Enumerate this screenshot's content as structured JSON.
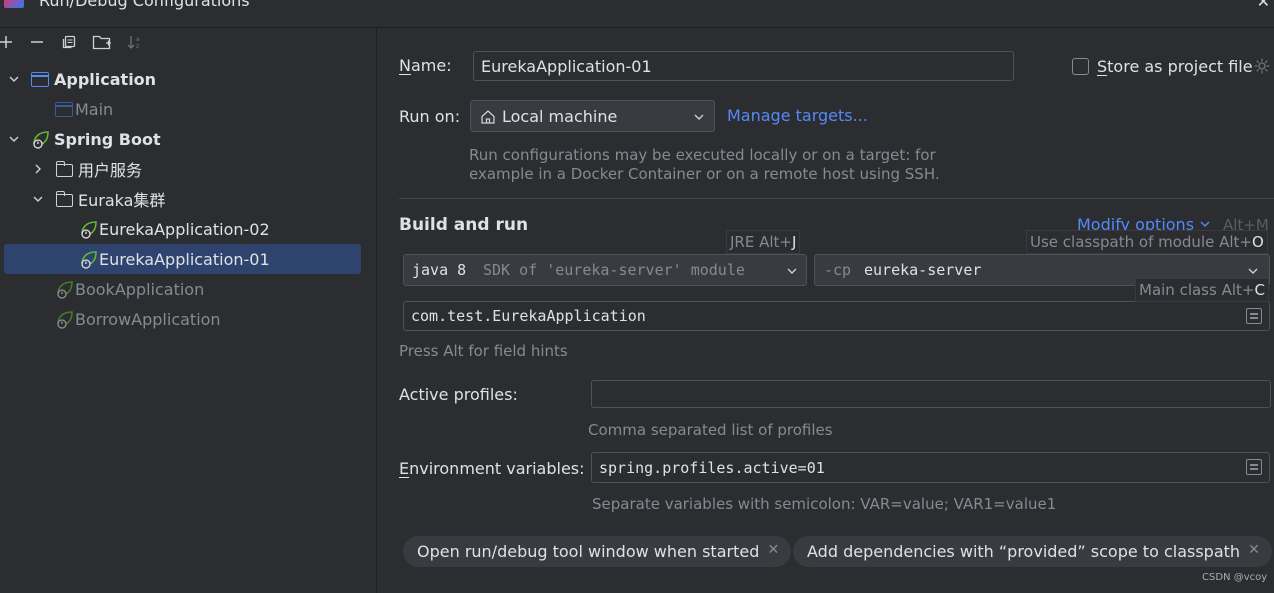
{
  "window": {
    "title": "Run/Debug Configurations"
  },
  "toolbar": {
    "icons": [
      "add-icon",
      "remove-icon",
      "copy-icon",
      "new-folder-icon",
      "sort-icon"
    ]
  },
  "tree": {
    "application": "Application",
    "main": "Main",
    "spring_boot": "Spring Boot",
    "folder_user": "用户服务",
    "folder_eureka": "Euraka集群",
    "eureka02": "EurekaApplication-02",
    "eureka01": "EurekaApplication-01",
    "book": "BookApplication",
    "borrow": "BorrowApplication"
  },
  "form": {
    "name_label": "Name:",
    "name_value": "EurekaApplication-01",
    "store_label": "Store as project file",
    "run_on_label": "Run on:",
    "run_on_value": "Local machine",
    "manage_targets": "Manage targets...",
    "run_on_hint_1": "Run configurations may be executed locally or on a target: for",
    "run_on_hint_2": "example in a Docker Container or on a remote host using SSH.",
    "build_and_run": "Build and run",
    "modify_options": "Modify options",
    "modify_shortcut": "Alt+M",
    "jre_tooltip": "JRE Alt+",
    "jre_tooltip_key": "J",
    "classpath_tooltip": "Use classpath of module Alt+",
    "classpath_tooltip_key": "O",
    "main_class_tooltip": "Main class Alt+",
    "main_class_tooltip_key": "C",
    "jdk_version": "java 8",
    "jdk_sdk": "SDK of 'eureka-server' module",
    "cp_flag": "-cp",
    "cp_module": "eureka-server",
    "main_class": "com.test.EurekaApplication",
    "field_hints": "Press Alt for field hints",
    "active_profiles_label": "Active profiles:",
    "active_profiles_value": "",
    "active_profiles_hint": "Comma separated list of profiles",
    "env_label": "Environment variables:",
    "env_value": "spring.profiles.active=01",
    "env_hint": "Separate variables with semicolon: VAR=value; VAR1=value1",
    "chip_open_tool": "Open run/debug tool window when started",
    "chip_add_deps": "Add dependencies with “provided” scope to classpath"
  },
  "watermark": "CSDN @vcoy",
  "colors": {
    "background": "#2b2d30",
    "selection": "#2e436e",
    "link": "#548af7",
    "spring_green": "#5fb832"
  }
}
